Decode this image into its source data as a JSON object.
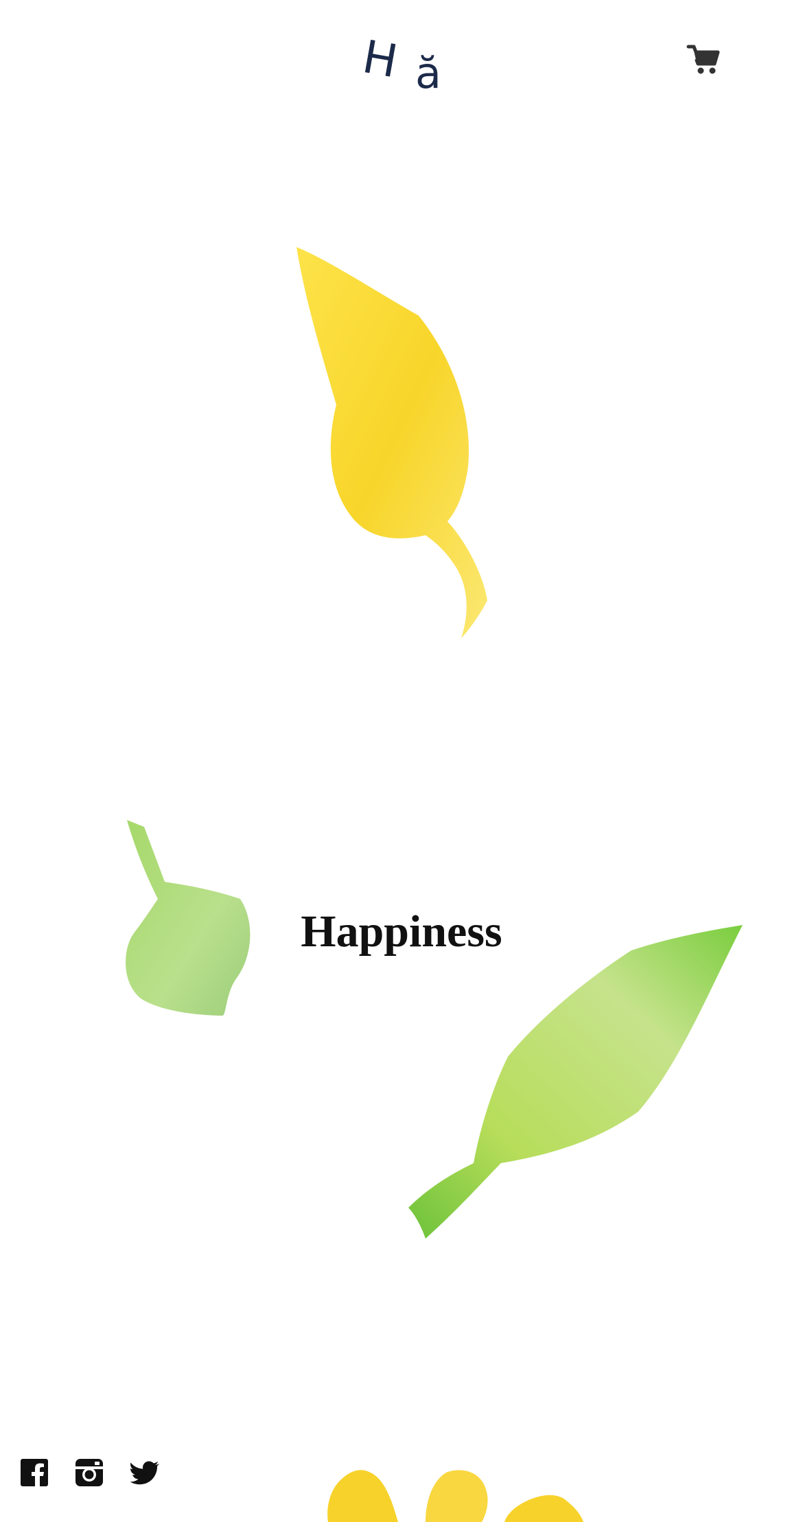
{
  "header": {
    "logo_first": "H",
    "logo_second": "ă",
    "cart_icon": "cart-icon"
  },
  "hero": {
    "title": "Happiness"
  },
  "colors": {
    "logo": "#1c2a4a",
    "icon": "#333333",
    "leaf_yellow": "#f7d51e",
    "leaf_green": "#8fd24a",
    "leaf_green_light": "#b6df86"
  },
  "social": {
    "icons": [
      "facebook-icon",
      "instagram-icon",
      "twitter-icon"
    ]
  }
}
